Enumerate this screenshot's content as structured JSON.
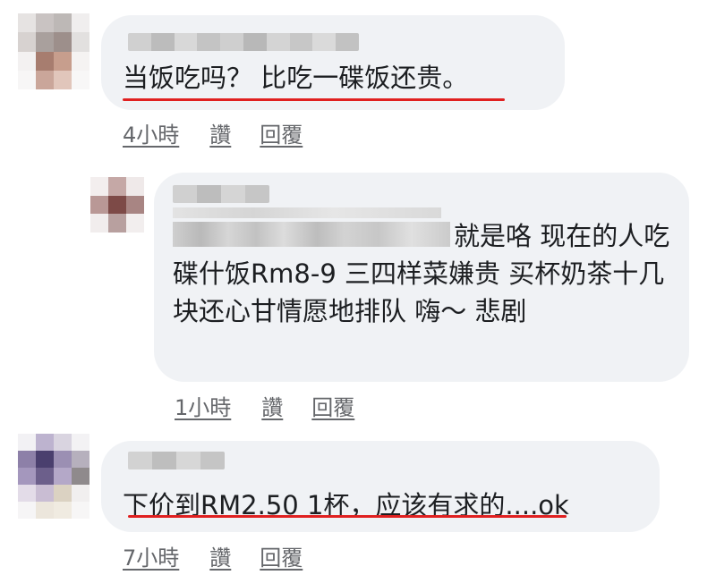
{
  "comments": [
    {
      "author_visible": "",
      "text": "当饭吃吗？ 比吃一碟饭还贵。",
      "time": "4小時",
      "like_label": "讚",
      "reply_label": "回覆"
    },
    {
      "author_visible": "",
      "text": "就是咯 现在的人吃碟什饭Rm8-9 三四样菜嫌贵 买杯奶茶十几块还心甘情愿地排队 嗨～ 悲剧",
      "time": "1小時",
      "like_label": "讚",
      "reply_label": "回覆"
    },
    {
      "author_visible": "",
      "text": "下价到RM2.50 1杯，应该有求的....ok",
      "time": "7小時",
      "like_label": "讚",
      "reply_label": "回覆"
    }
  ],
  "colors": {
    "bubble": "#f0f2f5",
    "text": "#1c1e21",
    "meta": "#65676b",
    "highlight_underline": "#e02020"
  }
}
